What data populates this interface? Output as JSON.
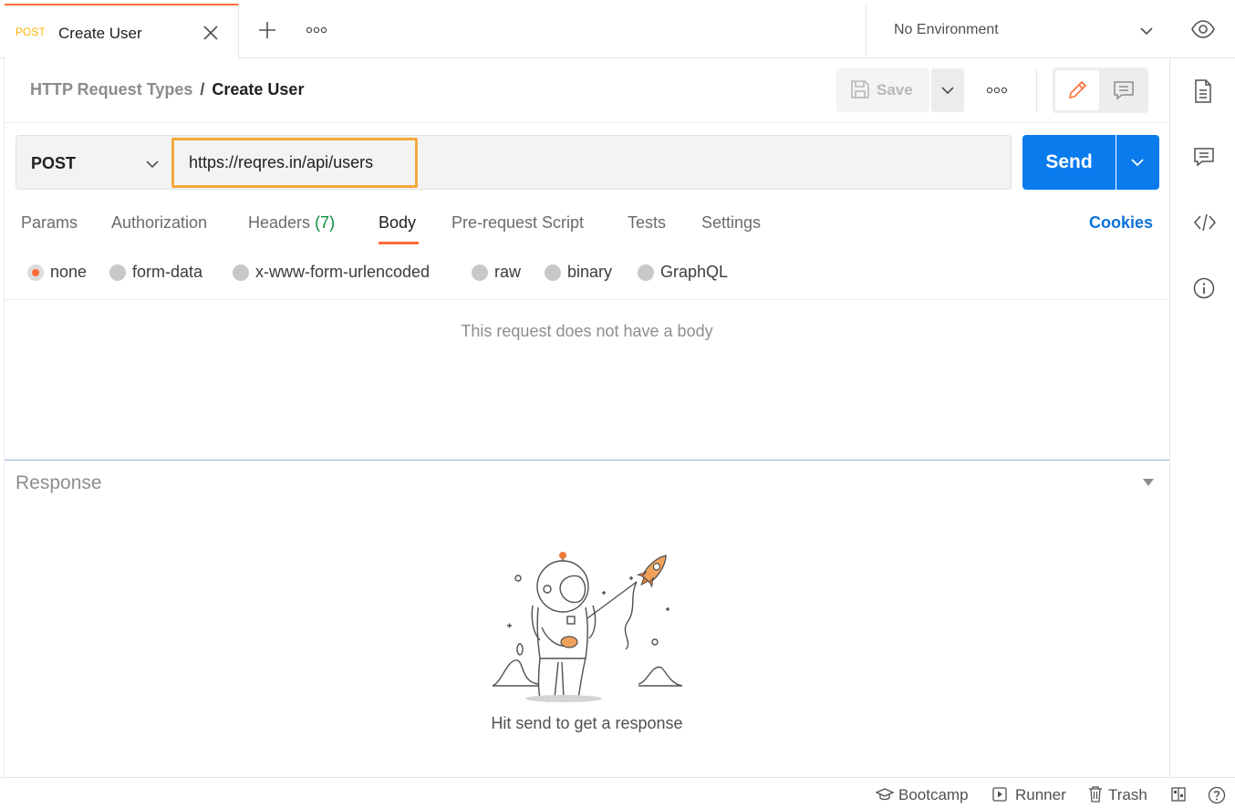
{
  "tab": {
    "method": "POST",
    "title": "Create User"
  },
  "environment": {
    "selected": "No Environment"
  },
  "breadcrumb": {
    "parent": "HTTP Request Types",
    "separator": "/",
    "current": "Create User"
  },
  "toolbar": {
    "save_label": "Save"
  },
  "request": {
    "method": "POST",
    "url": "https://reqres.in/api/users",
    "send_label": "Send"
  },
  "request_tabs": {
    "params": "Params",
    "authorization": "Authorization",
    "headers": "Headers",
    "headers_count": "(7)",
    "body": "Body",
    "pre_request_script": "Pre-request Script",
    "tests": "Tests",
    "settings": "Settings",
    "active": "Body",
    "cookies": "Cookies"
  },
  "body_types": {
    "none": "none",
    "form_data": "form-data",
    "urlencoded": "x-www-form-urlencoded",
    "raw": "raw",
    "binary": "binary",
    "graphql": "GraphQL",
    "selected": "none",
    "empty_message": "This request does not have a body"
  },
  "response": {
    "title": "Response",
    "empty_message": "Hit send to get a response"
  },
  "statusbar": {
    "bootcamp": "Bootcamp",
    "runner": "Runner",
    "trash": "Trash"
  },
  "colors": {
    "accent": "#ff6c37",
    "send": "#097bed",
    "cookies": "#0b73da",
    "headers_count": "#0c8d3c",
    "url_highlight": "#f2a93b",
    "post_method_tab": "#ffb400"
  }
}
